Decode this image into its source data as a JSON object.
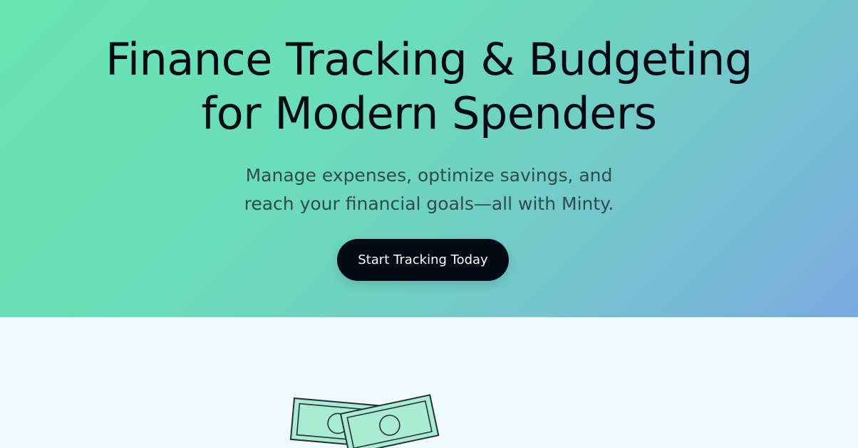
{
  "hero": {
    "title_line1": "Finance Tracking & Budgeting",
    "title_line2": "for Modern Spenders",
    "subtitle_line1": "Manage expenses, optimize savings, and",
    "subtitle_line2": "reach your financial goals—all with Minty.",
    "cta_label": "Start Tracking Today"
  },
  "colors": {
    "gradient_start": "#68e4b4",
    "gradient_end": "#7ba9e0",
    "cta_background": "#060a14",
    "page_background": "#f0f9fd",
    "bill_fill": "#a7ecd3",
    "bill_stroke": "#2a2f33"
  },
  "icons": {
    "illustration": "money-bills-icon"
  }
}
